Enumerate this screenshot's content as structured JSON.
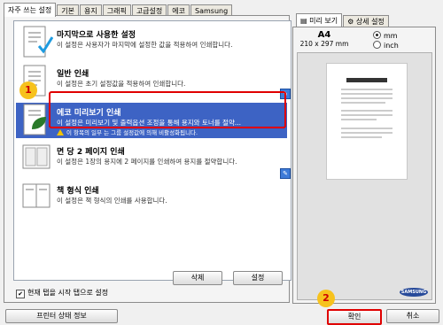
{
  "tabs": [
    "자주 쓰는 설정",
    "기본",
    "용지",
    "그래픽",
    "고급설정",
    "에코",
    "Samsung"
  ],
  "presets": [
    {
      "title": "마지막으로 사용한 설정",
      "desc": "이 설정은 사용자가 마지막에 설정한 값을 적용하여 인쇄합니다."
    },
    {
      "title": "일반 인쇄",
      "desc": "이 설정은 초기 설정값을 적용하여 인쇄합니다."
    },
    {
      "title": "에코 미리보기 인쇄",
      "desc": "이 설정은 미리보기 및 출력옵션 조정을 통해 용지와 토너를 절약...",
      "warning": "이 항목의 일부 는 그룹 설정값에 의해 비활성화됩니다."
    },
    {
      "title": "면 당 2 페이지 인쇄",
      "desc": "이 설정은 1장의 용지에 2 페이지를 인쇄하여 용지를 절약합니다."
    },
    {
      "title": "책 형식 인쇄",
      "desc": "이 설정은 책 형식의 인쇄를 사용합니다."
    }
  ],
  "buttons": {
    "delete": "삭제",
    "settings": "설정",
    "printer_status": "프린터 상태 정보",
    "ok": "확인",
    "cancel": "취소"
  },
  "checkbox": {
    "label": "현재 탭을 시작 탭으로 설정",
    "checked": true
  },
  "preview": {
    "tabs": [
      "미리 보기",
      "상세 설정"
    ],
    "paper": "A4",
    "size": "210 x 297 mm",
    "units": [
      "mm",
      "inch"
    ],
    "selected_unit": "mm",
    "brand": "SAMSUNG"
  },
  "callouts": [
    "1",
    "2"
  ],
  "colors": {
    "selection": "#3d63c4",
    "highlight": "#e00000",
    "callout": "#f7c21d"
  }
}
